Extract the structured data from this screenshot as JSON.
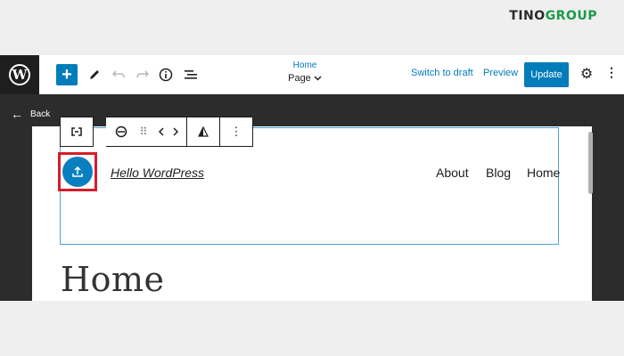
{
  "brand": {
    "part1": "TINO",
    "part2": "GROUP"
  },
  "toolbar": {
    "wp_logo": "W",
    "doc_title": "Home",
    "doc_type": "Page",
    "switch_to_draft": "Switch to draft",
    "preview": "Preview",
    "update": "Update"
  },
  "editor": {
    "back_label": "Back"
  },
  "header": {
    "site_title": "Hello WordPress",
    "nav": [
      "About",
      "Blog",
      "Home"
    ]
  },
  "content": {
    "page_heading": "Home"
  },
  "colors": {
    "accent": "#007cba",
    "selection_border": "#d51d2a",
    "block_outline": "#4fa1d8"
  }
}
